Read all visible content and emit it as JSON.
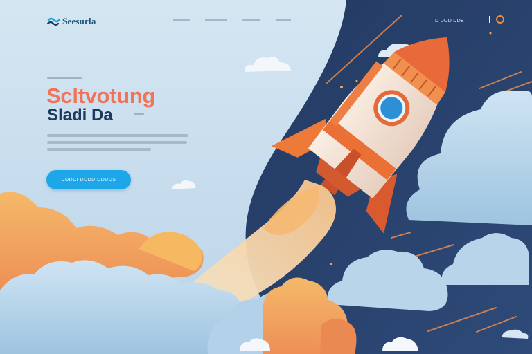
{
  "header": {
    "brand_name": "Seesurla",
    "nav_items": [
      {
        "label": ""
      },
      {
        "label": ""
      },
      {
        "label": ""
      },
      {
        "label": ""
      }
    ],
    "cta_link": "D DOD DDB",
    "logo_icon": "wave-logo-icon",
    "profile_icon": "ring-icon"
  },
  "hero": {
    "headline": "Scltvotung",
    "subheadline": "Sladi Da",
    "cta_button": "DDDDI DDDD DDDDS"
  },
  "colors": {
    "accent_orange": "#f0735a",
    "navy": "#1d3a5c",
    "button_blue": "#1da7e9",
    "space": "#27416b"
  },
  "illustration": {
    "subject": "rocket-illustration"
  }
}
